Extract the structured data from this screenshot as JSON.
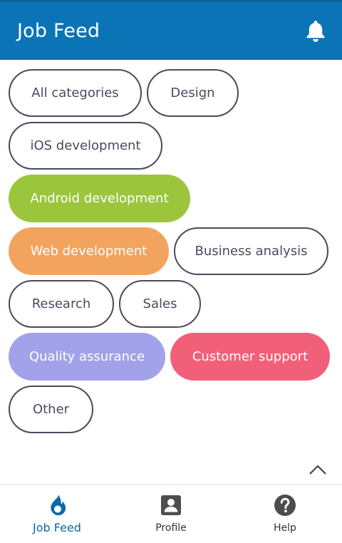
{
  "header": {
    "title": "Job Feed",
    "icon": "bell-icon"
  },
  "colors": {
    "primary": "#0a74b6",
    "android": "#9bc53d",
    "web": "#f2a45f",
    "qa": "#a2a2ea",
    "support": "#f25f79",
    "outline": "#4b4a5e"
  },
  "categories": [
    {
      "label": "All categories",
      "selected": false
    },
    {
      "label": "Design",
      "selected": false
    },
    {
      "label": "iOS development",
      "selected": false
    },
    {
      "label": "Android development",
      "selected": true,
      "color": "#9bc53d"
    },
    {
      "label": "Web development",
      "selected": true,
      "color": "#f2a45f"
    },
    {
      "label": "Business analysis",
      "selected": false
    },
    {
      "label": "Research",
      "selected": false
    },
    {
      "label": "Sales",
      "selected": false
    },
    {
      "label": "Quality assurance",
      "selected": true,
      "color": "#a2a2ea"
    },
    {
      "label": "Customer support",
      "selected": true,
      "color": "#f25f79"
    },
    {
      "label": "Other",
      "selected": false
    }
  ],
  "nav": {
    "items": [
      {
        "label": "Job Feed",
        "icon": "flame-icon",
        "active": true
      },
      {
        "label": "Profile",
        "icon": "profile-icon",
        "active": false
      },
      {
        "label": "Help",
        "icon": "help-icon",
        "active": false
      }
    ]
  }
}
